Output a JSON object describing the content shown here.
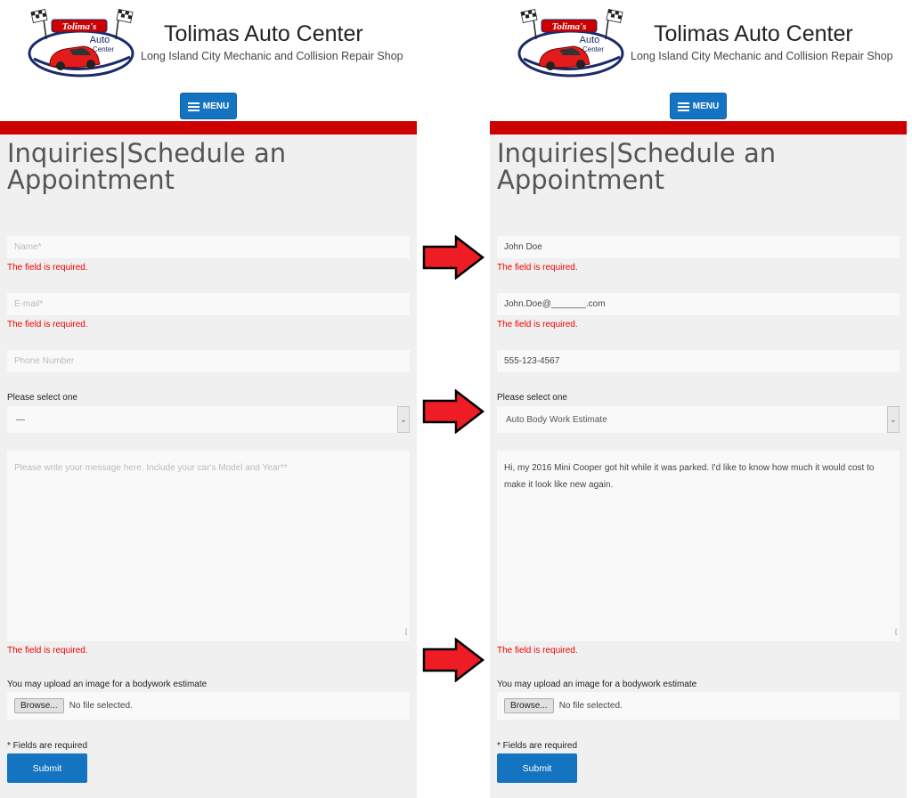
{
  "header": {
    "logo_text_top": "Tolima's",
    "logo_text_mid": "Auto",
    "logo_text_bottom": "Center",
    "site_title": "Tolimas Auto Center",
    "site_subtitle": "Long Island City Mechanic and Collision Repair Shop",
    "menu_label": "MENU"
  },
  "form": {
    "title": "Inquiries|Schedule an Appointment",
    "name_placeholder": "Name*",
    "email_placeholder": "E-mail*",
    "phone_placeholder": "Phone Number",
    "select_label": "Please select one",
    "select_default": "—",
    "message_placeholder": "Please write your message here. Include your car's Model and Year**",
    "required_error": "The field is required.",
    "upload_label": "You may upload an image for a bodywork estimate",
    "browse_label": "Browse...",
    "no_file_text": "No file selected.",
    "required_note": "* Fields are required",
    "submit_label": "Submit"
  },
  "filled": {
    "name_value": "John Doe",
    "email_value": "John.Doe@_______.com",
    "phone_value": "555-123-4567",
    "select_value": "Auto Body Work Estimate",
    "message_value": "Hi, my 2016 Mini Cooper got hit while it was parked. I'd like to know how much it would cost to make it look like new again."
  },
  "colors": {
    "accent_blue": "#1574c2",
    "header_red": "#cc0000",
    "error_red": "#ee0000",
    "arrow_red": "#ee1c24"
  },
  "icons": {
    "menu": "hamburger-icon",
    "select": "chevron-down-icon",
    "resize": "resize-grip-icon",
    "annotation": "red-arrow-icon"
  }
}
